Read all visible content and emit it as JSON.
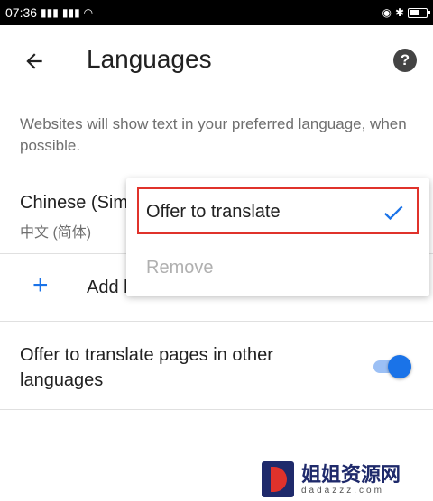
{
  "status_bar": {
    "time": "07:36",
    "signal_1": "3G",
    "signal_2": "4G"
  },
  "app_bar": {
    "title": "Languages",
    "back_icon": "arrow-left-icon",
    "help_icon": "help-circle-icon",
    "help_glyph": "?"
  },
  "description": "Websites will show text in your preferred language, when possible.",
  "language_item": {
    "name": "Chinese (Sim",
    "native": "中文 (简体)"
  },
  "add_language": {
    "icon": "plus-icon",
    "plus_glyph": "+",
    "label": "Add l"
  },
  "offer_setting": {
    "label": "Offer to translate pages in other languages",
    "enabled": true
  },
  "popup_menu": {
    "items": [
      {
        "label": "Offer to translate",
        "checked": true,
        "enabled": true
      },
      {
        "label": "Remove",
        "checked": false,
        "enabled": false
      }
    ]
  },
  "colors": {
    "accent": "#1a73e8",
    "highlight": "#e0322b"
  },
  "watermark": {
    "text": "姐姐资源网",
    "domain": "dadazzz.com"
  }
}
